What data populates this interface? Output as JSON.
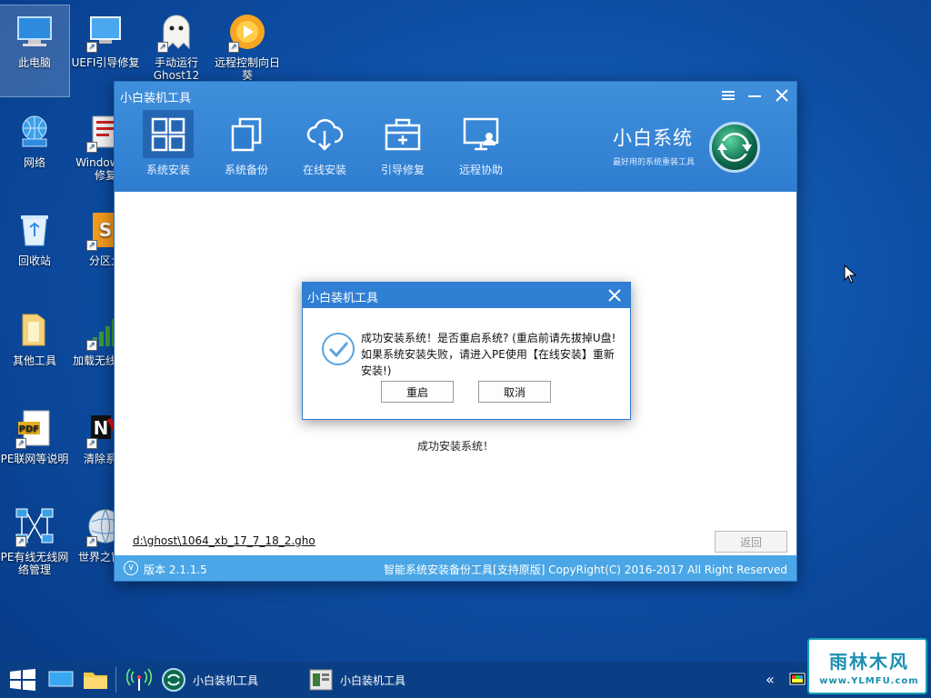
{
  "desktop": {
    "icons": [
      {
        "label": "此电脑"
      },
      {
        "label": "UEFI引导修复"
      },
      {
        "label": "手动运行Ghost12"
      },
      {
        "label": "远程控制向日葵"
      },
      {
        "label": "网络"
      },
      {
        "label": "Windows导修复"
      },
      {
        "label": "回收站"
      },
      {
        "label": "分区大"
      },
      {
        "label": "其他工具"
      },
      {
        "label": "加载无线驱动"
      },
      {
        "label": "PE联网等说明"
      },
      {
        "label": "清除系统"
      },
      {
        "label": "PE有线无线网络管理"
      },
      {
        "label": "世界之窗器"
      }
    ]
  },
  "window": {
    "title": "小白装机工具",
    "nav": [
      {
        "label": "系统安装"
      },
      {
        "label": "系统备份"
      },
      {
        "label": "在线安装"
      },
      {
        "label": "引导修复"
      },
      {
        "label": "远程协助"
      }
    ],
    "brand_name": "小白系统",
    "brand_slogan": "最好用的系统重装工具",
    "status_message": "成功安装系统！",
    "file_path": "d:\\ghost\\1064_xb_17_7_18_2.gho",
    "back_label": "返回",
    "version": "版本 2.1.1.5",
    "copyright": "智能系统安装备份工具[支持原版]   CopyRight(C) 2016-2017 All Right Reserved"
  },
  "dialog": {
    "title": "小白装机工具",
    "message": "成功安装系统！是否重启系统? (重启前请先拔掉U盘! 如果系统安装失败，请进入PE使用【在线安装】重新安装!)",
    "confirm_label": "重启",
    "cancel_label": "取消"
  },
  "taskbar": {
    "tasks": [
      {
        "label": "小白装机工具"
      },
      {
        "label": "小白装机工具"
      }
    ]
  },
  "watermark": {
    "text": "雨林木风",
    "url": "www.YLMFU.com"
  },
  "colors": {
    "header_blue": "#3389d8",
    "footer_blue": "#4aa6e6",
    "desktop_blue": "#0d4fa6",
    "taskbar": "#0b3f85"
  }
}
